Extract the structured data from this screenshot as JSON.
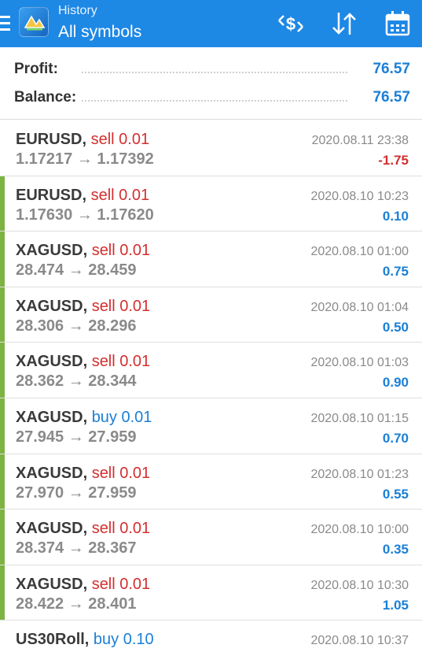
{
  "header": {
    "subtitle": "History",
    "title": "All symbols",
    "icons": [
      "menu-icon",
      "app-logo",
      "currency-exchange-icon",
      "sort-icon",
      "calendar-icon"
    ],
    "color": "#1e88e5"
  },
  "summary": {
    "profit_label": "Profit:",
    "profit_value": "76.57",
    "balance_label": "Balance:",
    "balance_value": "76.57"
  },
  "colors": {
    "sell": "#d32f2f",
    "buy": "#1a7fd6",
    "positive": "#1a7fd6",
    "negative": "#d32f2f",
    "marker": "#7cb342"
  },
  "deals": [
    {
      "symbol": "EURUSD,",
      "type": "sell 0.01",
      "side": "sell",
      "prices": "1.17217 → 1.17392",
      "time": "2020.08.11 23:38",
      "profit": "-1.75",
      "marked": false
    },
    {
      "symbol": "EURUSD,",
      "type": "sell 0.01",
      "side": "sell",
      "prices": "1.17630 → 1.17620",
      "time": "2020.08.10 10:23",
      "profit": "0.10",
      "marked": true
    },
    {
      "symbol": "XAGUSD,",
      "type": "sell 0.01",
      "side": "sell",
      "prices": "28.474 → 28.459",
      "time": "2020.08.10 01:00",
      "profit": "0.75",
      "marked": true
    },
    {
      "symbol": "XAGUSD,",
      "type": "sell 0.01",
      "side": "sell",
      "prices": "28.306 → 28.296",
      "time": "2020.08.10 01:04",
      "profit": "0.50",
      "marked": true
    },
    {
      "symbol": "XAGUSD,",
      "type": "sell 0.01",
      "side": "sell",
      "prices": "28.362 → 28.344",
      "time": "2020.08.10 01:03",
      "profit": "0.90",
      "marked": true
    },
    {
      "symbol": "XAGUSD,",
      "type": "buy 0.01",
      "side": "buy",
      "prices": "27.945 → 27.959",
      "time": "2020.08.10 01:15",
      "profit": "0.70",
      "marked": true
    },
    {
      "symbol": "XAGUSD,",
      "type": "sell 0.01",
      "side": "sell",
      "prices": "27.970 → 27.959",
      "time": "2020.08.10 01:23",
      "profit": "0.55",
      "marked": true
    },
    {
      "symbol": "XAGUSD,",
      "type": "sell 0.01",
      "side": "sell",
      "prices": "28.374 → 28.367",
      "time": "2020.08.10 10:00",
      "profit": "0.35",
      "marked": true
    },
    {
      "symbol": "XAGUSD,",
      "type": "sell 0.01",
      "side": "sell",
      "prices": "28.422 → 28.401",
      "time": "2020.08.10 10:30",
      "profit": "1.05",
      "marked": true
    },
    {
      "symbol": "US30Roll,",
      "type": "buy 0.10",
      "side": "buy",
      "prices": "",
      "time": "2020.08.10 10:37",
      "profit": "",
      "marked": false
    }
  ]
}
